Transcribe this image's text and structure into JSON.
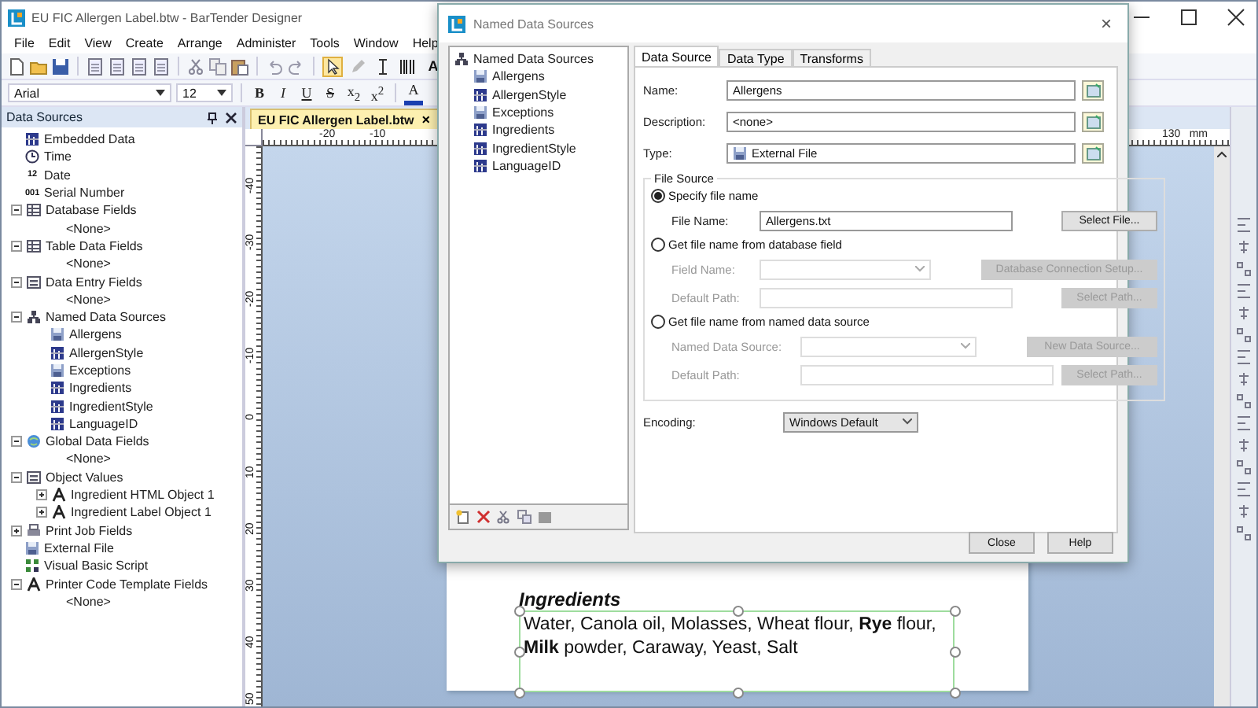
{
  "window": {
    "title": "EU FIC Allergen Label.btw - BarTender Designer"
  },
  "menu": [
    "File",
    "Edit",
    "View",
    "Create",
    "Arrange",
    "Administer",
    "Tools",
    "Window",
    "Help"
  ],
  "toolbar": {
    "tools": [
      {
        "kind": "pointer",
        "selected": true
      },
      {
        "kind": "pen",
        "selected": false
      },
      {
        "kind": "text",
        "selected": false
      },
      {
        "kind": "barcode",
        "selected": false
      }
    ],
    "tool_letter": "A"
  },
  "format_bar": {
    "font": "Arial",
    "size": "12",
    "styles": [
      {
        "kind": "bold",
        "label": "B"
      },
      {
        "kind": "italic",
        "label": "I"
      },
      {
        "kind": "underline",
        "label": "U"
      },
      {
        "kind": "strike",
        "label": "S"
      },
      {
        "kind": "sub",
        "label": "x$_{2}$"
      },
      {
        "kind": "sup",
        "label": "x$^{2}$"
      }
    ],
    "color_letter": "A",
    "color": "#1a3fb0"
  },
  "data_sources": {
    "title": "Data Sources",
    "items": [
      {
        "label": "Embedded Data",
        "kind": "grid"
      },
      {
        "label": "Time",
        "kind": "clock"
      },
      {
        "label": "Date",
        "kind": "calendar",
        "badge": "12"
      },
      {
        "label": "Serial Number",
        "kind": "serial",
        "badge": "001"
      },
      {
        "label": "Database Fields",
        "kind": "table",
        "expanded": true,
        "children": [
          {
            "label": "<None>"
          }
        ]
      },
      {
        "label": "Table Data Fields",
        "kind": "table",
        "expanded": true,
        "children": [
          {
            "label": "<None>"
          }
        ]
      },
      {
        "label": "Data Entry Fields",
        "kind": "form",
        "expanded": true,
        "children": [
          {
            "label": "<None>"
          }
        ]
      },
      {
        "label": "Named Data Sources",
        "kind": "nodes",
        "expanded": true,
        "children": [
          {
            "label": "Allergens",
            "kind": "disk"
          },
          {
            "label": "AllergenStyle",
            "kind": "grid"
          },
          {
            "label": "Exceptions",
            "kind": "disk"
          },
          {
            "label": "Ingredients",
            "kind": "grid"
          },
          {
            "label": "IngredientStyle",
            "kind": "grid"
          },
          {
            "label": "LanguageID",
            "kind": "grid"
          }
        ]
      },
      {
        "label": "Global Data Fields",
        "kind": "globe",
        "expanded": true,
        "children": [
          {
            "label": "<None>"
          }
        ]
      },
      {
        "label": "Object Values",
        "kind": "form",
        "expanded": true,
        "children": [
          {
            "label": "Ingredient HTML Object 1",
            "kind": "letter",
            "expanded": false
          },
          {
            "label": "Ingredient Label Object 1",
            "kind": "letter",
            "expanded": false
          }
        ]
      },
      {
        "label": "Print Job Fields",
        "kind": "printer",
        "expanded": false
      },
      {
        "label": "External File",
        "kind": "disk"
      },
      {
        "label": "Visual Basic Script",
        "kind": "script"
      },
      {
        "label": "Printer Code Template Fields",
        "kind": "letter",
        "expanded": true,
        "children": [
          {
            "label": "<None>"
          }
        ]
      }
    ]
  },
  "document_tab": {
    "label": "EU FIC Allergen Label.btw",
    "close": "×"
  },
  "ruler": {
    "unit": "mm",
    "x_labels": [
      "-20",
      "-10",
      "130"
    ],
    "y_labels": [
      "-40",
      "-30",
      "-20",
      "-10",
      "0",
      "10",
      "20",
      "30",
      "40",
      "50"
    ]
  },
  "label": {
    "heading": "Ingredients",
    "body": "Water, Canola oil, Molasses, Wheat flour, **Rye** flour, **Milk** powder, Caraway, Yeast, Salt"
  },
  "dialog": {
    "title": "Named Data Sources",
    "close": "×",
    "tree": {
      "label": "Named Data Sources",
      "children": [
        {
          "label": "Allergens",
          "kind": "disk",
          "selected": false
        },
        {
          "label": "AllergenStyle",
          "kind": "grid",
          "selected": false
        },
        {
          "label": "Exceptions",
          "kind": "disk",
          "selected": false
        },
        {
          "label": "Ingredients",
          "kind": "grid",
          "selected": false
        },
        {
          "label": "IngredientStyle",
          "kind": "grid",
          "selected": false
        },
        {
          "label": "LanguageID",
          "kind": "grid",
          "selected": false
        }
      ]
    },
    "tabs": [
      {
        "label": "Data Source",
        "selected": true
      },
      {
        "label": "Data Type",
        "selected": false
      },
      {
        "label": "Transforms",
        "selected": false
      }
    ],
    "name": {
      "label": "Name:",
      "value": "Allergens"
    },
    "description": {
      "label": "Description:",
      "value": "<none>"
    },
    "type": {
      "label": "Type:",
      "value": "External File"
    },
    "file_source": {
      "title": "File Source",
      "options": [
        {
          "label": "Specify file name",
          "selected": true,
          "rows": [
            {
              "label": "File Name:",
              "kind": "text",
              "value": "Allergens.txt",
              "button": "Select File..."
            }
          ]
        },
        {
          "label": "Get file name from database field",
          "selected": false,
          "rows": [
            {
              "label": "Field Name:",
              "kind": "combo",
              "button": "Database Connection Setup..."
            },
            {
              "label": "Default Path:",
              "kind": "text",
              "button": "Select Path..."
            }
          ]
        },
        {
          "label": "Get file name from named data source",
          "selected": false,
          "rows": [
            {
              "label": "Named Data Source:",
              "kind": "combo",
              "button": "New Data Source..."
            },
            {
              "label": "Default Path:",
              "kind": "text",
              "button": "Select Path..."
            }
          ]
        }
      ]
    },
    "encoding": {
      "label": "Encoding:",
      "value": "Windows Default"
    },
    "buttons": [
      "Close",
      "Help"
    ]
  }
}
